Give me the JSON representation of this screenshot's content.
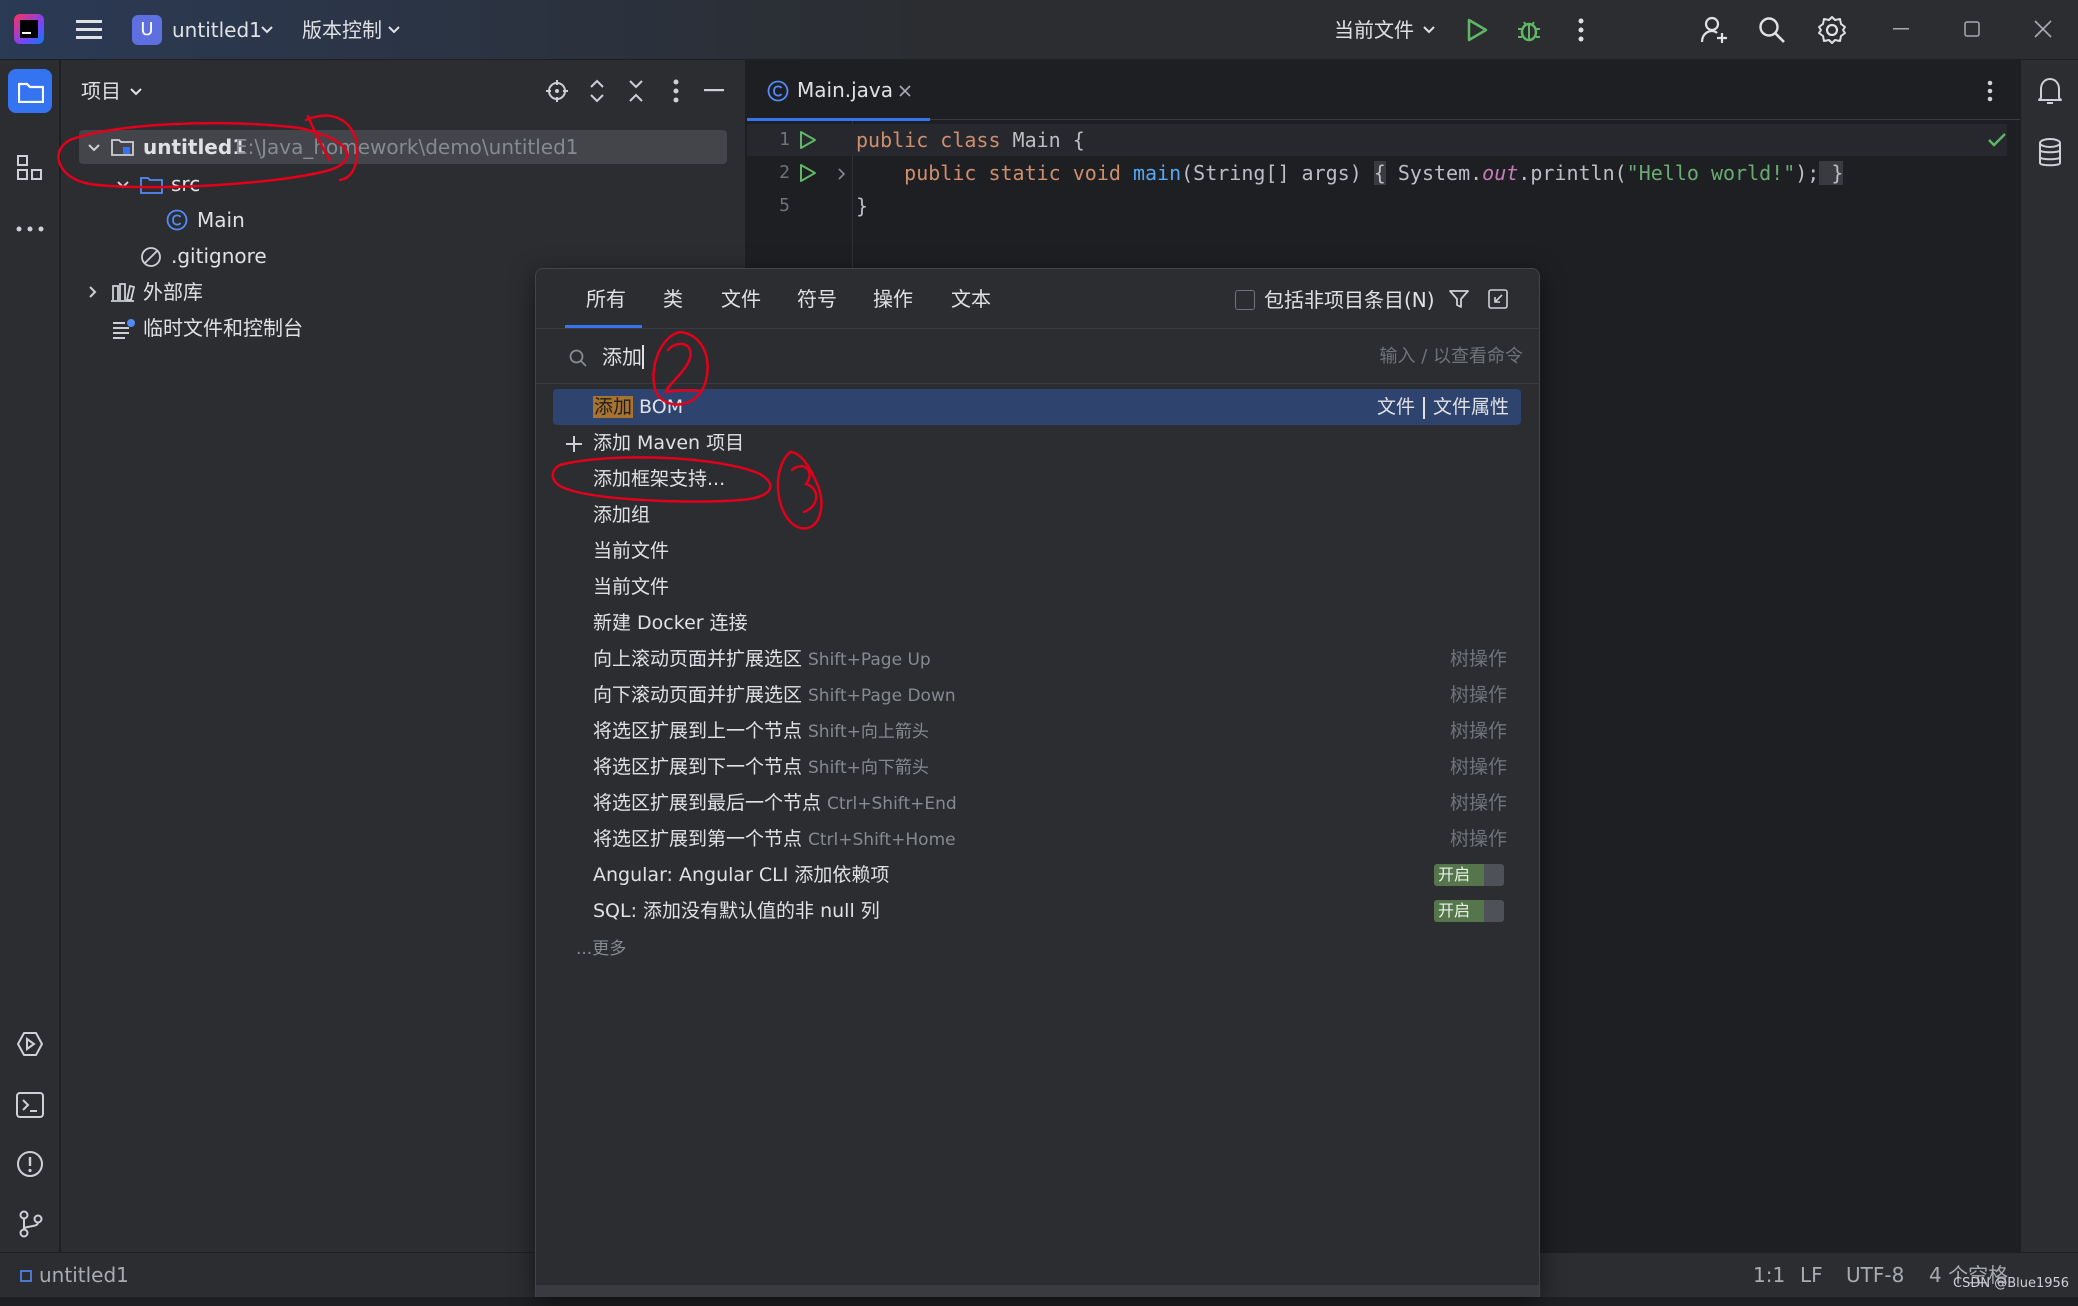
{
  "titlebar": {
    "project_badge": "U",
    "project_name": "untitled1",
    "vcs_menu": "版本控制",
    "run_config": "当前文件"
  },
  "project_panel": {
    "title": "项目",
    "tree": [
      {
        "label": "untitled1",
        "path": "E:\\Java_homework\\demo\\untitled1"
      },
      {
        "label": "src"
      },
      {
        "label": "Main"
      },
      {
        "label": ".gitignore"
      },
      {
        "label": "外部库"
      },
      {
        "label": "临时文件和控制台"
      }
    ]
  },
  "editor": {
    "tab_label": "Main.java",
    "line_numbers": [
      "1",
      "2",
      "5"
    ],
    "line1": {
      "kw": "public class ",
      "rest": "Main {"
    },
    "line2": {
      "indent": "    ",
      "kw": "public static void ",
      "fn": "main",
      "params": "(String[] args) ",
      "brace_open": "{",
      "sys": " System.",
      "out": "out",
      "print": ".println(",
      "str": "\"Hello world!\"",
      "end": ");",
      "brace_close": " }"
    },
    "line3": "}"
  },
  "search_popup": {
    "tabs": [
      "所有",
      "类",
      "文件",
      "符号",
      "操作",
      "文本"
    ],
    "checkbox_label": "包括非项目条目(N)",
    "query": "添加",
    "hint": "输入 / 以查看命令",
    "results": [
      {
        "highlight": "添加",
        "rest": " BOM",
        "category": "文件",
        "category2": "文件属性"
      },
      {
        "label": "添加 Maven 项目"
      },
      {
        "label": "添加框架支持..."
      },
      {
        "label": "添加组"
      },
      {
        "label": "当前文件"
      },
      {
        "label": "当前文件"
      },
      {
        "label": "新建 Docker 连接"
      },
      {
        "label": "向上滚动页面并扩展选区",
        "shortcut": "Shift+Page Up",
        "category": "树操作"
      },
      {
        "label": "向下滚动页面并扩展选区",
        "shortcut": "Shift+Page Down",
        "category": "树操作"
      },
      {
        "label": "将选区扩展到上一个节点",
        "shortcut": "Shift+向上箭头",
        "category": "树操作"
      },
      {
        "label": "将选区扩展到下一个节点",
        "shortcut": "Shift+向下箭头",
        "category": "树操作"
      },
      {
        "label": "将选区扩展到最后一个节点",
        "shortcut": "Ctrl+Shift+End",
        "category": "树操作"
      },
      {
        "label": "将选区扩展到第一个节点",
        "shortcut": "Ctrl+Shift+Home",
        "category": "树操作"
      },
      {
        "label": "Angular: Angular CLI 添加依赖项",
        "toggle": "开启"
      },
      {
        "label": "SQL: 添加没有默认值的非 null 列",
        "toggle": "开启"
      }
    ],
    "more": "...更多"
  },
  "statusbar": {
    "project": "untitled1",
    "position": "1:1",
    "line_sep": "LF",
    "encoding": "UTF-8",
    "indent": "4 个空格",
    "watermark": "CSDN @Blue1956"
  },
  "annotations": [
    "1",
    "2",
    "3"
  ],
  "colors": {
    "accent": "#3574f0",
    "selection": "#2e436e",
    "annotation_red": "#e3001b"
  }
}
